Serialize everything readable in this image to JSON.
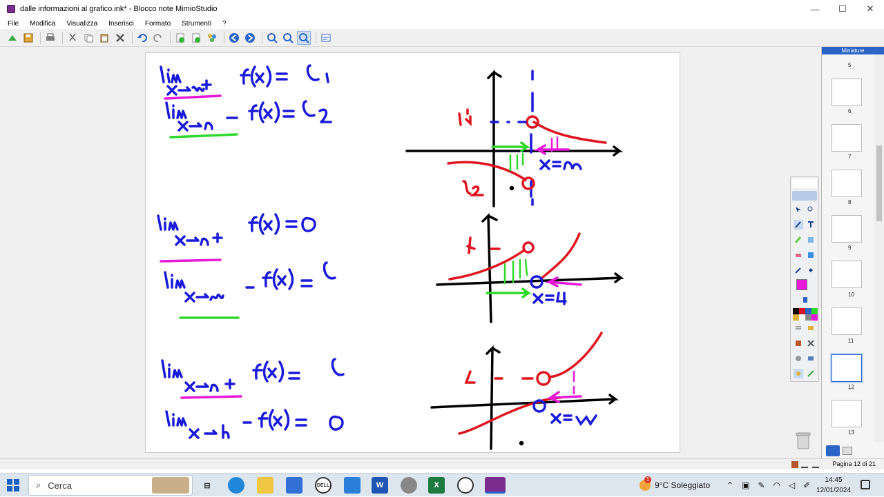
{
  "window": {
    "title": "dalle informazioni al grafico.ink* - Blocco note MimioStudio"
  },
  "menu": [
    "File",
    "Modifica",
    "Visualizza",
    "Inserisci",
    "Formato",
    "Strumenti",
    "?"
  ],
  "panel": {
    "header": "Miniature",
    "pages": [
      "5",
      "6",
      "7",
      "8",
      "9",
      "10",
      "11",
      "12",
      "13"
    ],
    "selected": "12"
  },
  "status": {
    "page_label": "Pagina 12 di 21"
  },
  "taskbar": {
    "search_placeholder": "Cerca",
    "weather": "9°C  Soleggiato",
    "time": "14:45",
    "date": "12/01/2024",
    "weather_badge": "1"
  },
  "colors": {
    "ink_blue": "#1a1adb",
    "ink_red": "#e0141e",
    "ink_magenta": "#e619d9",
    "ink_green": "#2fd82a",
    "ink_black": "#000000",
    "accent": "#2b63c7"
  }
}
